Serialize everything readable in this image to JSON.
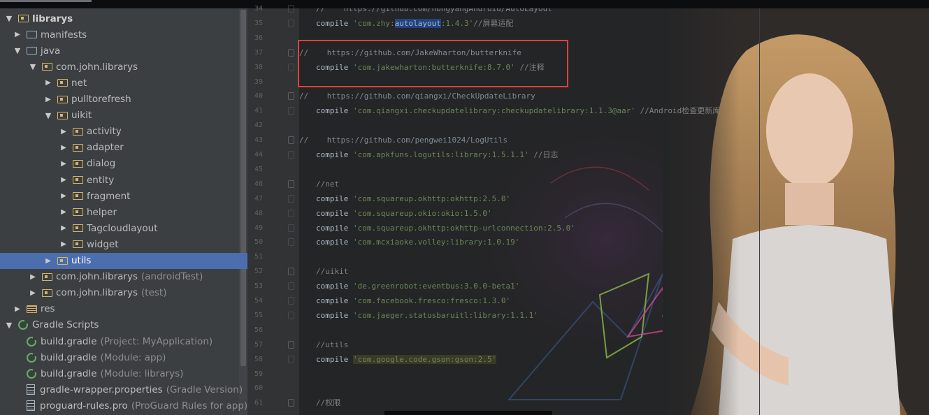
{
  "tree": {
    "items": [
      {
        "label": "librarys",
        "hint": "",
        "indent": 0,
        "arrow": "down",
        "icon": "module-folder-icon",
        "bold": true
      },
      {
        "label": "manifests",
        "hint": "",
        "indent": 1,
        "arrow": "right",
        "icon": "folder-icon"
      },
      {
        "label": "java",
        "hint": "",
        "indent": 1,
        "arrow": "down",
        "icon": "folder-icon"
      },
      {
        "label": "com.john.librarys",
        "hint": "",
        "indent": 2,
        "arrow": "down",
        "icon": "package-icon"
      },
      {
        "label": "net",
        "hint": "",
        "indent": 3,
        "arrow": "right",
        "icon": "package-icon"
      },
      {
        "label": "pulltorefresh",
        "hint": "",
        "indent": 3,
        "arrow": "right",
        "icon": "package-icon"
      },
      {
        "label": "uikit",
        "hint": "",
        "indent": 3,
        "arrow": "down",
        "icon": "package-icon"
      },
      {
        "label": "activity",
        "hint": "",
        "indent": 4,
        "arrow": "right",
        "icon": "package-icon"
      },
      {
        "label": "adapter",
        "hint": "",
        "indent": 4,
        "arrow": "right",
        "icon": "package-icon"
      },
      {
        "label": "dialog",
        "hint": "",
        "indent": 4,
        "arrow": "right",
        "icon": "package-icon"
      },
      {
        "label": "entity",
        "hint": "",
        "indent": 4,
        "arrow": "right",
        "icon": "package-icon"
      },
      {
        "label": "fragment",
        "hint": "",
        "indent": 4,
        "arrow": "right",
        "icon": "package-icon"
      },
      {
        "label": "helper",
        "hint": "",
        "indent": 4,
        "arrow": "right",
        "icon": "package-icon"
      },
      {
        "label": "Tagcloudlayout",
        "hint": "",
        "indent": 4,
        "arrow": "right",
        "icon": "package-icon"
      },
      {
        "label": "widget",
        "hint": "",
        "indent": 4,
        "arrow": "right",
        "icon": "package-icon"
      },
      {
        "label": "utils",
        "hint": "",
        "indent": 3,
        "arrow": "right",
        "icon": "package-icon",
        "selected": true
      },
      {
        "label": "com.john.librarys",
        "hint": "(androidTest)",
        "indent": 2,
        "arrow": "right",
        "icon": "package-icon"
      },
      {
        "label": "com.john.librarys",
        "hint": "(test)",
        "indent": 2,
        "arrow": "right",
        "icon": "package-icon"
      },
      {
        "label": "res",
        "hint": "",
        "indent": 1,
        "arrow": "right",
        "icon": "res-folder-icon"
      },
      {
        "label": "Gradle Scripts",
        "hint": "",
        "indent": 0,
        "arrow": "down",
        "icon": "gradle-icon"
      },
      {
        "label": "build.gradle",
        "hint": "(Project: MyApplication)",
        "indent": 1,
        "arrow": "",
        "icon": "gradle-icon"
      },
      {
        "label": "build.gradle",
        "hint": "(Module: app)",
        "indent": 1,
        "arrow": "",
        "icon": "gradle-icon"
      },
      {
        "label": "build.gradle",
        "hint": "(Module: librarys)",
        "indent": 1,
        "arrow": "",
        "icon": "gradle-icon"
      },
      {
        "label": "gradle-wrapper.properties",
        "hint": "(Gradle Version)",
        "indent": 1,
        "arrow": "",
        "icon": "properties-file-icon"
      },
      {
        "label": "proguard-rules.pro",
        "hint": "(ProGuard Rules for app)",
        "indent": 1,
        "arrow": "",
        "icon": "text-file-icon"
      }
    ]
  },
  "editor": {
    "lines": [
      {
        "num": "34",
        "parts": [
          {
            "t": "cmt",
            "v": "//    https://github.com/hongyangAndroid/AutoLayout"
          }
        ]
      },
      {
        "num": "35",
        "parts": [
          {
            "t": "kw",
            "v": "compile "
          },
          {
            "t": "str",
            "v": "'com.zhy:"
          },
          {
            "t": "hl",
            "v": "autolayout"
          },
          {
            "t": "str",
            "v": ":1.4.3'"
          },
          {
            "t": "cmt",
            "v": "//屏幕适配"
          }
        ]
      },
      {
        "num": "36",
        "parts": []
      },
      {
        "num": "37",
        "parts": [
          {
            "t": "cmt",
            "v": "//    https://github.com/JakeWharton/butterknife"
          }
        ],
        "outdent": true
      },
      {
        "num": "38",
        "parts": [
          {
            "t": "kw",
            "v": "compile "
          },
          {
            "t": "str",
            "v": "'com.jakewharton:butterknife:8.7.0'"
          },
          {
            "t": "cmt",
            "v": " //注释"
          }
        ]
      },
      {
        "num": "39",
        "parts": []
      },
      {
        "num": "40",
        "parts": [
          {
            "t": "cmt",
            "v": "//    https://github.com/qiangxi/CheckUpdateLibrary"
          }
        ],
        "outdent": true
      },
      {
        "num": "41",
        "parts": [
          {
            "t": "kw",
            "v": "compile "
          },
          {
            "t": "str",
            "v": "'com.qiangxi.checkupdatelibrary:checkupdatelibrary:1.1.3@aar'"
          },
          {
            "t": "cmt",
            "v": " //Android检查更新库"
          }
        ]
      },
      {
        "num": "42",
        "parts": []
      },
      {
        "num": "43",
        "parts": [
          {
            "t": "cmt",
            "v": "//    https://github.com/pengwei1024/LogUtils"
          }
        ],
        "outdent": true
      },
      {
        "num": "44",
        "parts": [
          {
            "t": "kw",
            "v": "compile "
          },
          {
            "t": "str",
            "v": "'com.apkfuns.logutils:library:1.5.1.1'"
          },
          {
            "t": "cmt",
            "v": " //日志"
          }
        ]
      },
      {
        "num": "45",
        "parts": []
      },
      {
        "num": "46",
        "parts": [
          {
            "t": "cmt",
            "v": "//net"
          }
        ]
      },
      {
        "num": "47",
        "parts": [
          {
            "t": "kw",
            "v": "compile "
          },
          {
            "t": "str",
            "v": "'com.squareup.okhttp:okhttp:2.5.0'"
          }
        ]
      },
      {
        "num": "48",
        "parts": [
          {
            "t": "kw",
            "v": "compile "
          },
          {
            "t": "str",
            "v": "'com.squareup.okio:okio:1.5.0'"
          }
        ]
      },
      {
        "num": "49",
        "parts": [
          {
            "t": "kw",
            "v": "compile "
          },
          {
            "t": "str",
            "v": "'com.squareup.okhttp:okhttp-urlconnection:2.5.0'"
          }
        ]
      },
      {
        "num": "50",
        "parts": [
          {
            "t": "kw",
            "v": "compile "
          },
          {
            "t": "str",
            "v": "'com.mcxiaoke.volley:library:1.0.19'"
          }
        ]
      },
      {
        "num": "51",
        "parts": []
      },
      {
        "num": "52",
        "parts": [
          {
            "t": "cmt",
            "v": "//uikit"
          }
        ]
      },
      {
        "num": "53",
        "parts": [
          {
            "t": "kw",
            "v": "compile "
          },
          {
            "t": "str",
            "v": "'de.greenrobot:eventbus:3.0.0-beta1'"
          }
        ]
      },
      {
        "num": "54",
        "parts": [
          {
            "t": "kw",
            "v": "compile "
          },
          {
            "t": "str",
            "v": "'com.facebook.fresco:fresco:1.3.0'"
          }
        ]
      },
      {
        "num": "55",
        "parts": [
          {
            "t": "kw",
            "v": "compile "
          },
          {
            "t": "str",
            "v": "'com.jaeger.statusbaruitl:library:1.1.1'"
          }
        ]
      },
      {
        "num": "56",
        "parts": []
      },
      {
        "num": "57",
        "parts": [
          {
            "t": "cmt",
            "v": "//utils"
          }
        ]
      },
      {
        "num": "58",
        "parts": [
          {
            "t": "kw",
            "v": "compile "
          },
          {
            "t": "strhl",
            "v": "'com.google.code.gson:gson:2.5'"
          }
        ]
      },
      {
        "num": "59",
        "parts": []
      },
      {
        "num": "60",
        "parts": []
      },
      {
        "num": "61",
        "parts": [
          {
            "t": "cmt",
            "v": "//权限"
          }
        ]
      }
    ]
  },
  "colors": {
    "selection": "#4b6eaf",
    "annotation_box": "#e0403f",
    "string": "#6a8759",
    "comment": "#808080"
  }
}
